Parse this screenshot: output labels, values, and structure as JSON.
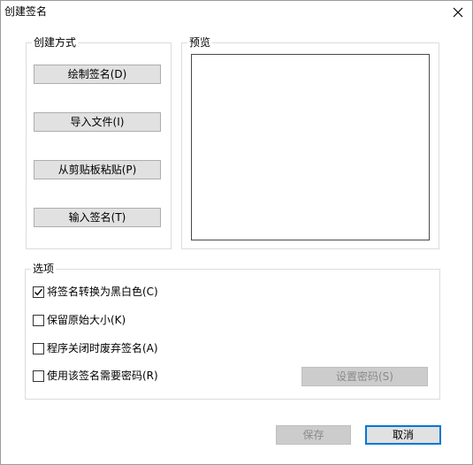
{
  "window": {
    "title": "创建签名",
    "close_icon": "close-icon"
  },
  "create_method": {
    "label": "创建方式",
    "buttons": [
      "绘制签名(D)",
      "导入文件(I)",
      "从剪贴板粘贴(P)",
      "输入签名(T)"
    ]
  },
  "preview": {
    "label": "预览"
  },
  "options": {
    "label": "选项",
    "checkboxes": [
      {
        "label": "将签名转换为黑白色(C)",
        "checked": true
      },
      {
        "label": "保留原始大小(K)",
        "checked": false
      },
      {
        "label": "程序关闭时废弃签名(A)",
        "checked": false
      },
      {
        "label": "使用该签名需要密码(R)",
        "checked": false
      }
    ],
    "set_password_label": "设置密码(S)",
    "set_password_enabled": false
  },
  "footer": {
    "save_label": "保存",
    "save_enabled": false,
    "cancel_label": "取消"
  },
  "colors": {
    "accent": "#0078d7",
    "button_face": "#e1e1e1",
    "disabled_face": "#cccccc"
  }
}
